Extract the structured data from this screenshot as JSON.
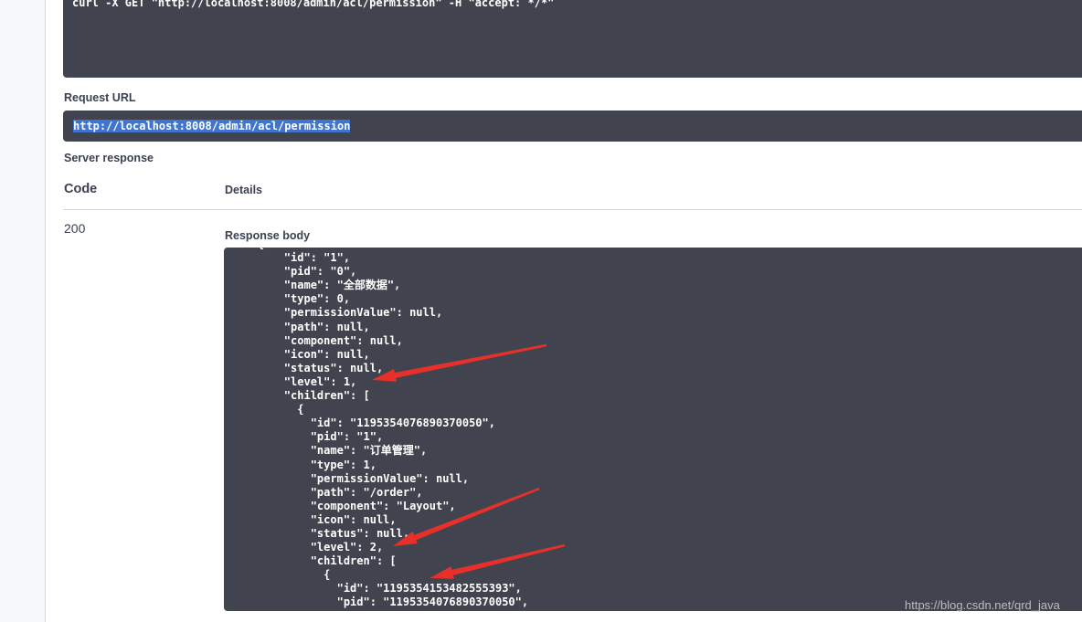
{
  "curl": {
    "command": "curl -X GET \"http://localhost:8008/admin/acl/permission\" -H \"accept: */*\""
  },
  "request_url": {
    "label": "Request URL",
    "value": "http://localhost:8008/admin/acl/permission"
  },
  "server_response": {
    "label": "Server response",
    "columns": {
      "code": "Code",
      "details": "Details"
    },
    "status_code": "200",
    "body_label": "Response body",
    "body_lines": [
      "    {",
      "        \"id\": \"1\",",
      "        \"pid\": \"0\",",
      "        \"name\": \"全部数据\",",
      "        \"type\": 0,",
      "        \"permissionValue\": null,",
      "        \"path\": null,",
      "        \"component\": null,",
      "        \"icon\": null,",
      "        \"status\": null,",
      "        \"level\": 1,",
      "        \"children\": [",
      "          {",
      "            \"id\": \"1195354076890370050\",",
      "            \"pid\": \"1\",",
      "            \"name\": \"订单管理\",",
      "            \"type\": 1,",
      "            \"permissionValue\": null,",
      "            \"path\": \"/order\",",
      "            \"component\": \"Layout\",",
      "            \"icon\": null,",
      "            \"status\": null,",
      "            \"level\": 2,",
      "            \"children\": [",
      "              {",
      "                \"id\": \"1195354153482555393\",",
      "                \"pid\": \"1195354076890370050\","
    ]
  },
  "annotation": {
    "arrow_color": "#e8302b"
  },
  "watermark": {
    "text": "https://blog.csdn.net/qrd_java"
  }
}
